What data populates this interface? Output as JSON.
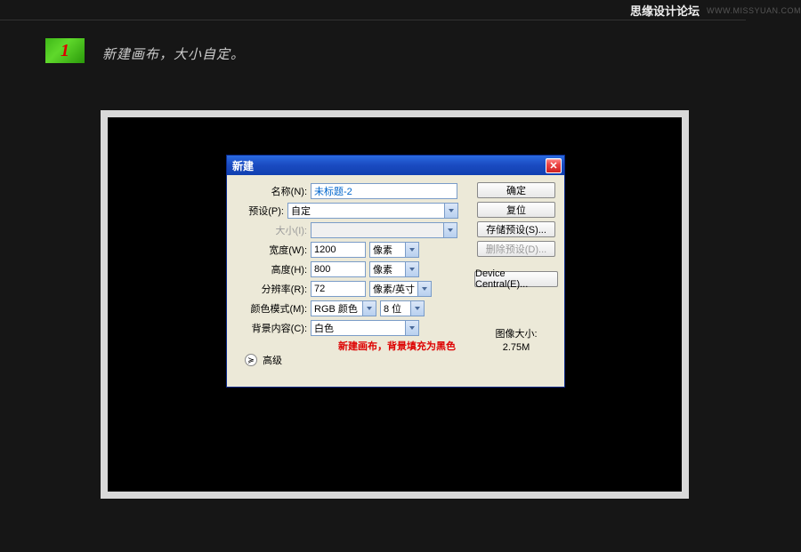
{
  "header": {
    "title": "思缘设计论坛",
    "url": "WWW.MISSYUAN.COM"
  },
  "step": {
    "num": "1",
    "text": "新建画布，大小自定。"
  },
  "dialog": {
    "title": "新建",
    "close": "✕",
    "name": {
      "label": "名称(N):",
      "value": "未标题-2"
    },
    "preset": {
      "label": "预设(P):",
      "value": "自定"
    },
    "size": {
      "label": "大小(I):",
      "value": ""
    },
    "width": {
      "label": "宽度(W):",
      "value": "1200",
      "unit": "像素"
    },
    "height": {
      "label": "高度(H):",
      "value": "800",
      "unit": "像素"
    },
    "resolution": {
      "label": "分辨率(R):",
      "value": "72",
      "unit": "像素/英寸"
    },
    "colormode": {
      "label": "颜色模式(M):",
      "value": "RGB 颜色",
      "bits": "8 位"
    },
    "bg": {
      "label": "背景内容(C):",
      "value": "白色"
    },
    "advanced": "高级",
    "note": "新建画布，背景填充为黑色",
    "btns": {
      "ok": "确定",
      "reset": "复位",
      "save": "存储预设(S)...",
      "delete": "删除预设(D)...",
      "device": "Device Central(E)..."
    },
    "info": {
      "size_label": "图像大小:",
      "size_value": "2.75M"
    }
  }
}
